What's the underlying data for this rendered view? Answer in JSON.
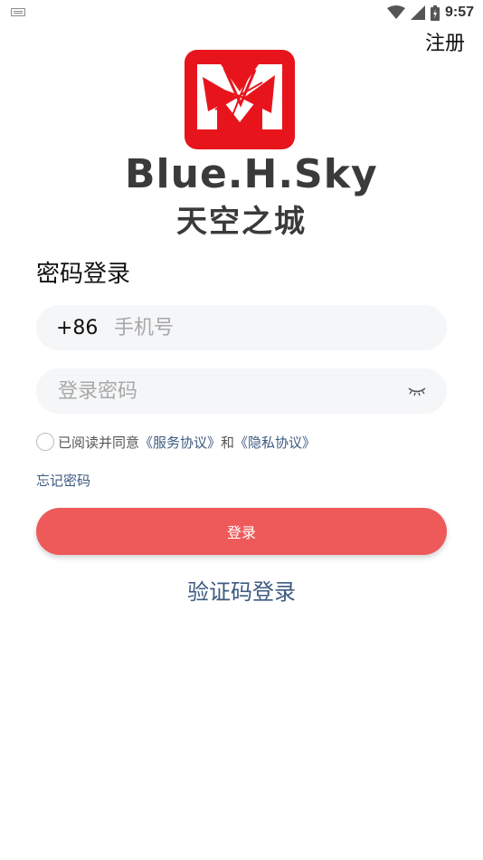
{
  "status_bar": {
    "time": "9:57"
  },
  "header": {
    "register_label": "注册"
  },
  "brand": {
    "name": "Blue.H.Sky",
    "subtitle": "天空之城",
    "logo_color": "#e8141c"
  },
  "form": {
    "title": "密码登录",
    "phone": {
      "prefix": "+86",
      "placeholder": "手机号"
    },
    "password": {
      "placeholder": "登录密码"
    },
    "agreement": {
      "prefix_text": "已阅读并同意",
      "service_link": "《服务协议》",
      "and_text": "和",
      "privacy_link": "《隐私协议》"
    },
    "forgot_label": "忘记密码",
    "login_label": "登录",
    "code_login_label": "验证码登录"
  },
  "colors": {
    "accent": "#ee5a5a",
    "link": "#3d5a80",
    "field_bg": "#f5f6f8"
  }
}
